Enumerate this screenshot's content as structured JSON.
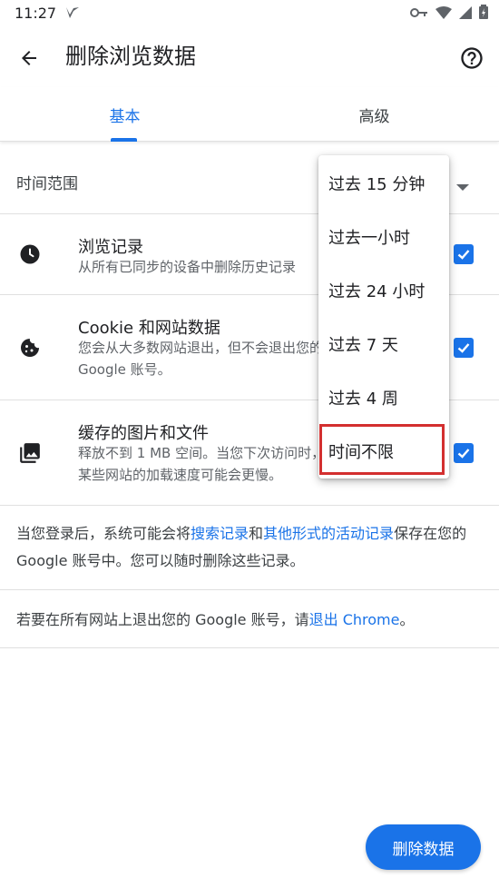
{
  "status_bar": {
    "time": "11:27"
  },
  "header": {
    "title": "删除浏览数据"
  },
  "tabs": [
    {
      "label": "基本",
      "selected": true
    },
    {
      "label": "高级",
      "selected": false
    }
  ],
  "time_range": {
    "label": "时间范围"
  },
  "items": [
    {
      "title": "浏览记录",
      "description": "从所有已同步的设备中删除历史记录",
      "checked": true,
      "icon": "clock-icon"
    },
    {
      "title": "Cookie 和网站数据",
      "description": "您会从大多数网站退出，但不会退出您的 Google 账号。",
      "checked": true,
      "icon": "cookie-icon"
    },
    {
      "title": "缓存的图片和文件",
      "description": "释放不到 1 MB 空间。当您下次访问时，某些网站的加载速度可能会更慢。",
      "checked": true,
      "icon": "image-icon"
    }
  ],
  "info1": {
    "part1": "当您登录后，系统可能会将",
    "link1": "搜索记录",
    "part2": "和",
    "link2": "其他形式的活动记录",
    "part3": "保存在您的 Google 账号中。您可以随时删除这些记录。"
  },
  "info2": {
    "part1": "若要在所有网站上退出您的 Google 账号，请",
    "link": "退出 Chrome",
    "part2": "。"
  },
  "delete_button": "删除数据",
  "dropdown": {
    "options": [
      "过去 15 分钟",
      "过去一小时",
      "过去 24 小时",
      "过去 7 天",
      "过去 4 周",
      "时间不限"
    ],
    "highlighted": "时间不限"
  },
  "colors": {
    "accent": "#1a73e8",
    "highlight_border": "#d32f2f"
  }
}
